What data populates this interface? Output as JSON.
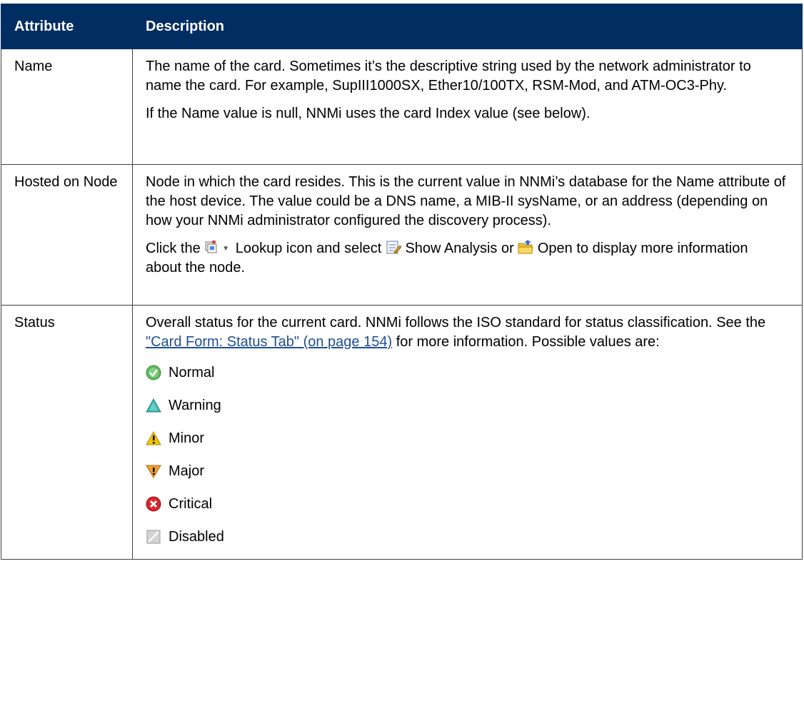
{
  "table": {
    "headers": {
      "attribute": "Attribute",
      "description": "Description"
    },
    "name_row": {
      "attribute": "Name",
      "p1": "The name of the card. Sometimes it’s the descriptive string used by the network administrator to name the card. For example, SupIII1000SX, Ether10/100TX, RSM-Mod, and ATM-OC3-Phy.",
      "p2": "If the Name value is null, NNMi uses the card Index value (see below)."
    },
    "hosted_row": {
      "attribute": "Hosted on Node",
      "p1": "Node in which the card resides. This is the current value in NNMi’s database for the Name attribute of the host device. The value could be a DNS name, a MIB-II sysName, or an address (depending on how your NNMi administrator configured the discovery process).",
      "p2_a": "Click the",
      "p2_b": "Lookup icon and select",
      "p2_c": "Show Analysis or",
      "p2_d": "Open to display more information about the node.",
      "icons": [
        "lookup-icon",
        "show-analysis-icon",
        "open-icon"
      ]
    },
    "status_row": {
      "attribute": "Status",
      "p1_a": "Overall status for the current card. NNMi follows the ISO standard for status classification. See the",
      "link": "\"Card Form: Status Tab\" (on page 154)",
      "p1_b": "for more information. Possible values are:",
      "values": [
        {
          "label": "Normal",
          "icon": "normal-status-icon",
          "color": "#5cb85c"
        },
        {
          "label": "Warning",
          "icon": "warning-status-icon",
          "color": "#3cb8b0"
        },
        {
          "label": "Minor",
          "icon": "minor-status-icon",
          "color": "#f2c400"
        },
        {
          "label": "Major",
          "icon": "major-status-icon",
          "color": "#f0a030"
        },
        {
          "label": "Critical",
          "icon": "critical-status-icon",
          "color": "#d9262c"
        },
        {
          "label": "Disabled",
          "icon": "disabled-status-icon",
          "color": "#b0b0b0"
        }
      ]
    }
  },
  "colors": {
    "header_bg": "#002d62",
    "link": "#1f4f8f",
    "border": "#404040"
  }
}
